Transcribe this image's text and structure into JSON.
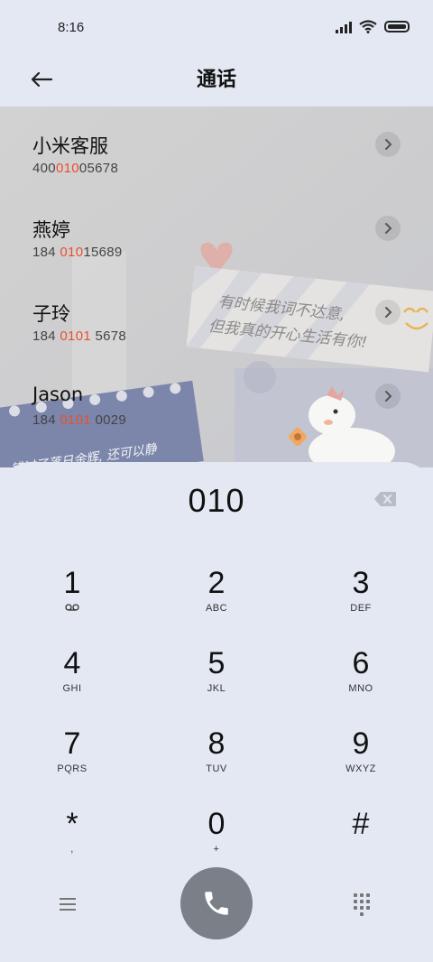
{
  "status": {
    "time": "8:16"
  },
  "header": {
    "title": "通话"
  },
  "contacts": [
    {
      "name": "小米客服",
      "num_pre": "400",
      "num_hl": "010",
      "num_post": "05678"
    },
    {
      "name": "燕婷",
      "num_pre": "184 ",
      "num_hl": "010",
      "num_post": "15689"
    },
    {
      "name": "子玲",
      "num_pre": "184 ",
      "num_hl": "0101",
      "num_post": " 5678"
    },
    {
      "name": "Jason",
      "num_pre": "184 ",
      "num_hl": "0101",
      "num_post": " 0029"
    }
  ],
  "wallpaper": {
    "note1": "有时候我词不达意,",
    "note2": "但我真的开心生活有你!",
    "note3": "错过了落日余辉, 还可以静"
  },
  "dialer": {
    "input": "010",
    "keys": [
      {
        "digit": "1",
        "letters": "ꝏ"
      },
      {
        "digit": "2",
        "letters": "ABC"
      },
      {
        "digit": "3",
        "letters": "DEF"
      },
      {
        "digit": "4",
        "letters": "GHI"
      },
      {
        "digit": "5",
        "letters": "JKL"
      },
      {
        "digit": "6",
        "letters": "MNO"
      },
      {
        "digit": "7",
        "letters": "PQRS"
      },
      {
        "digit": "8",
        "letters": "TUV"
      },
      {
        "digit": "9",
        "letters": "WXYZ"
      },
      {
        "digit": "*",
        "letters": ","
      },
      {
        "digit": "0",
        "letters": "+"
      },
      {
        "digit": "#",
        "letters": ""
      }
    ]
  },
  "icons": {
    "back": "arrow-left-icon",
    "chevron": "chevron-right-icon",
    "backspace": "backspace-icon",
    "menu": "menu-icon",
    "call": "phone-icon",
    "keypad": "dialpad-icon"
  },
  "colors": {
    "highlight": "#e8502f",
    "call_button": "#7b7f87",
    "background": "#e3e8f3"
  }
}
